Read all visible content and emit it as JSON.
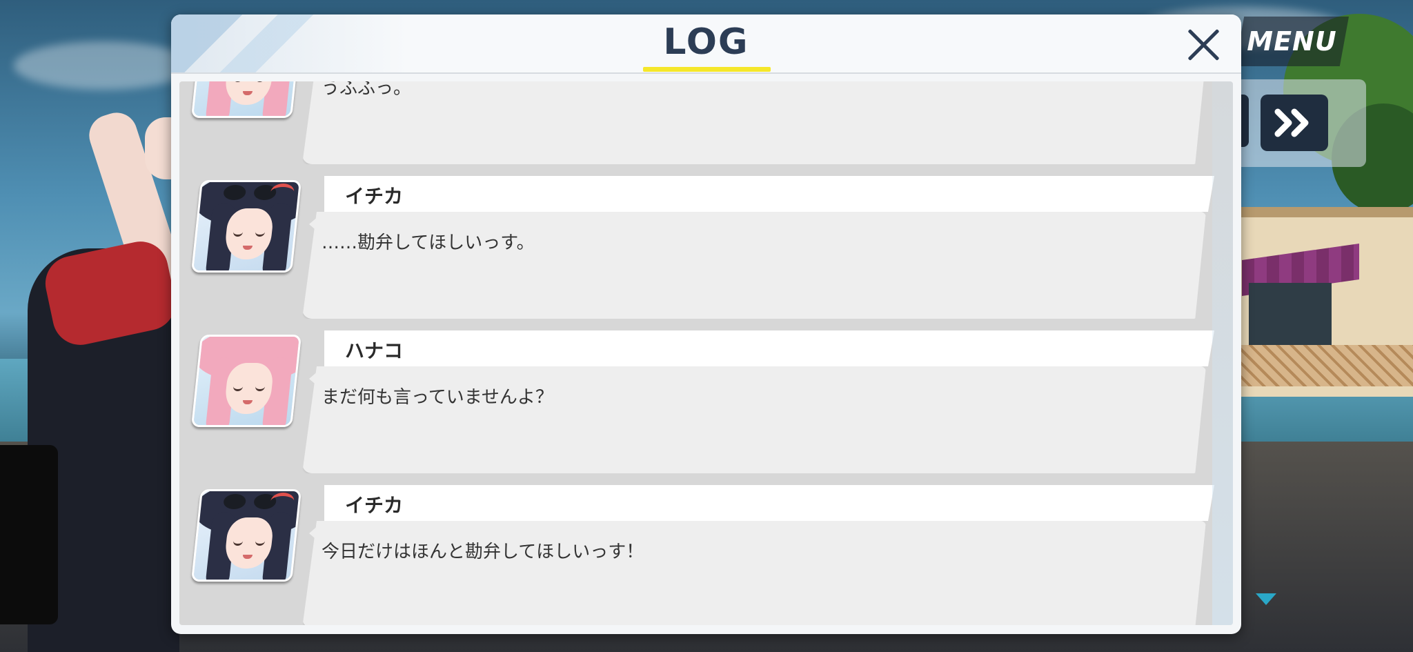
{
  "hud": {
    "menu_label": "MENU",
    "skip_icon": "fast-forward-icon",
    "scroll_indicator_icon": "triangle-down-icon"
  },
  "log": {
    "title": "LOG",
    "close_icon": "close-icon",
    "accent_color": "#f5e72a",
    "entries": [
      {
        "speaker": "",
        "avatar": "hanako",
        "text": "うふふっ。"
      },
      {
        "speaker": "イチカ",
        "avatar": "ichika",
        "text": "……勘弁してほしいっす。"
      },
      {
        "speaker": "ハナコ",
        "avatar": "hanako",
        "text": "まだ何も言っていませんよ？"
      },
      {
        "speaker": "イチカ",
        "avatar": "ichika",
        "text": "今日だけはほんと勘弁してほしいっす！"
      }
    ]
  }
}
